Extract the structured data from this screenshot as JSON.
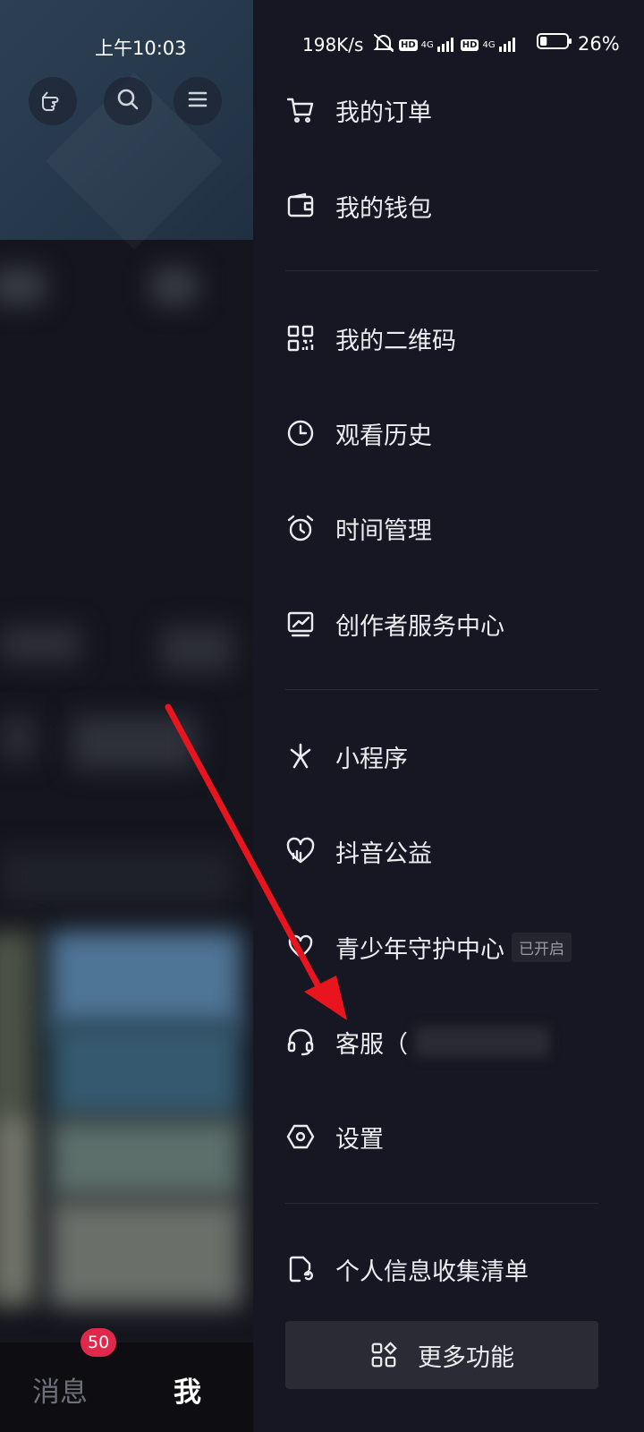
{
  "status_bar": {
    "time": "上午10:03",
    "net_speed": "198K/s",
    "network1": "4G",
    "network2": "4G",
    "hd": "HD",
    "battery_percent": "26%",
    "battery_level": 0.26
  },
  "background": {
    "bottom_nav": {
      "messages_label": "消息",
      "messages_badge": "50",
      "me_label": "我"
    }
  },
  "drawer": {
    "items": [
      {
        "label": "我的订单",
        "icon": "cart-icon"
      },
      {
        "label": "我的钱包",
        "icon": "wallet-icon"
      },
      {
        "label": "我的二维码",
        "icon": "qrcode-icon"
      },
      {
        "label": "观看历史",
        "icon": "clock-icon"
      },
      {
        "label": "时间管理",
        "icon": "alarm-icon"
      },
      {
        "label": "创作者服务中心",
        "icon": "chart-monitor-icon"
      },
      {
        "label": "小程序",
        "icon": "asterisk-icon"
      },
      {
        "label": "抖音公益",
        "icon": "heart-icon"
      },
      {
        "label": "青少年守护中心",
        "icon": "shield-heart-icon",
        "tag": "已开启"
      },
      {
        "label": "客服（",
        "icon": "headset-icon"
      },
      {
        "label": "设置",
        "icon": "settings-hex-icon"
      },
      {
        "label": "个人信息收集清单",
        "icon": "doc-refresh-icon"
      }
    ],
    "more_button": {
      "label": "更多功能",
      "icon": "grid-plus-icon"
    }
  },
  "colors": {
    "background": "#161722",
    "divider": "#2a2b35",
    "badge": "#e0294a",
    "annotation_arrow": "#e8141e"
  }
}
